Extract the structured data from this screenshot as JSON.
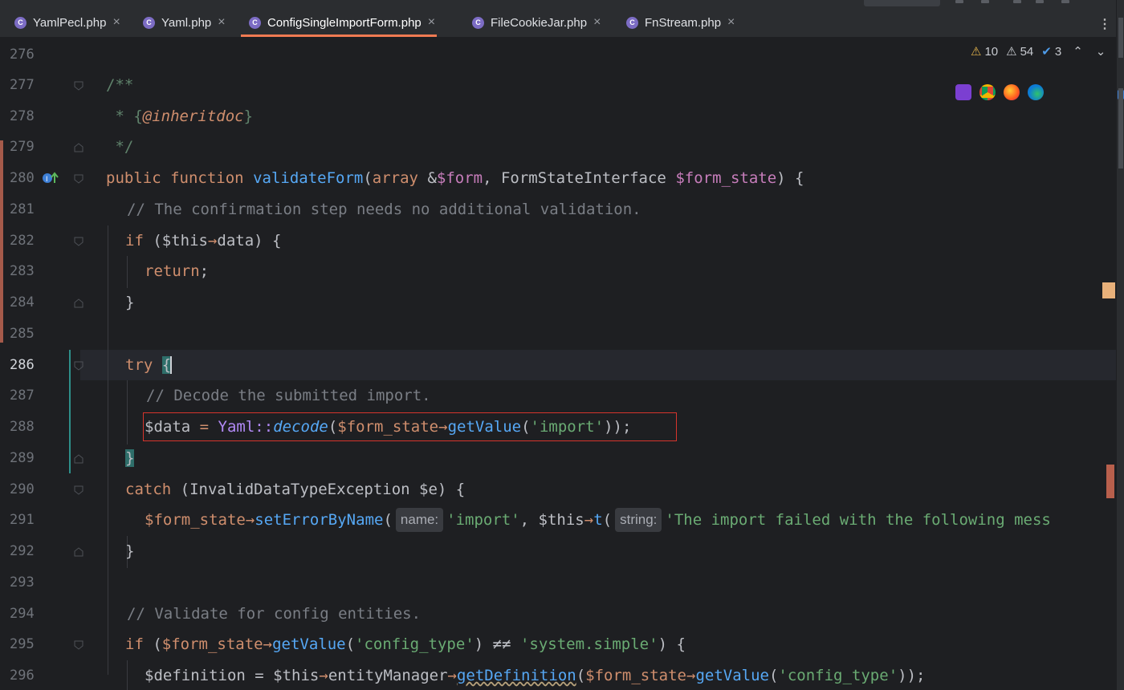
{
  "tabs": [
    {
      "label": "YamlPecl.php",
      "active": false
    },
    {
      "label": "Yaml.php",
      "active": false
    },
    {
      "label": "ConfigSingleImportForm.php",
      "active": true
    },
    {
      "label": "FileCookieJar.php",
      "active": false
    },
    {
      "label": "FnStream.php",
      "active": false
    }
  ],
  "inspections": {
    "weak_warnings": "10",
    "warnings": "54",
    "typos": "3"
  },
  "browsers": [
    "phpstorm-icon",
    "chrome-icon",
    "firefox-icon",
    "edge-icon"
  ],
  "current_line": "286",
  "lines": [
    "276",
    "277",
    "278",
    "279",
    "280",
    "281",
    "282",
    "283",
    "284",
    "285",
    "286",
    "287",
    "288",
    "289",
    "290",
    "291",
    "292",
    "293",
    "294",
    "295",
    "296"
  ],
  "code": {
    "l277": "/**",
    "l278_star": " * {",
    "l278_tag": "@inheritdoc",
    "l278_end": "}",
    "l279": " */",
    "l280_kw1": "public",
    "l280_kw2": "function",
    "l280_fn": "validateForm",
    "l280_p1": "(",
    "l280_kw3": "array",
    "l280_amp": " &",
    "l280_v1": "$form",
    "l280_c": ", FormStateInterface ",
    "l280_v2": "$form_state",
    "l280_end": ") {",
    "l281": "// The confirmation step needs no additional validation.",
    "l282_kw": "if",
    "l282_a": " ($this",
    "l282_arrow": "→",
    "l282_b": "data) {",
    "l283_kw": "return",
    "l283_end": ";",
    "l284": "}",
    "l286_kw": "try",
    "l286_brace": "{",
    "l287": "// Decode the submitted import.",
    "l288_v": "$data",
    "l288_eq": " = ",
    "l288_cls": "Yaml",
    "l288_sep": "::",
    "l288_fn": "decode",
    "l288_p": "(",
    "l288_v2": "$form_state",
    "l288_arrow": "→",
    "l288_m": "getValue",
    "l288_p2": "(",
    "l288_s": "'import'",
    "l288_end": "));",
    "l289": "}",
    "l290_kw": "catch",
    "l290_rest": " (InvalidDataTypeException $e) {",
    "l291_v": "$form_state",
    "l291_arrow": "→",
    "l291_m": "setErrorByName",
    "l291_p": "(",
    "l291_hint1": "name:",
    "l291_s1": "'import'",
    "l291_c": ", $this",
    "l291_arrow2": "→",
    "l291_t": "t",
    "l291_p2": "(",
    "l291_hint2": "string:",
    "l291_s2": "'The import failed with the following mess",
    "l292": "}",
    "l294": "// Validate for config entities.",
    "l295_kw": "if",
    "l295_a": " (",
    "l295_v": "$form_state",
    "l295_arrow": "→",
    "l295_m": "getValue",
    "l295_p": "(",
    "l295_s1": "'config_type'",
    "l295_neq": ") ≠≠ ",
    "l295_s2": "'system.simple'",
    "l295_end": ") {",
    "l296_v": "$definition",
    "l296_eq": " = $this",
    "l296_arrow": "→",
    "l296_prop": "entityManager",
    "l296_arrow2": "→",
    "l296_m": "getDefinition",
    "l296_p": "(",
    "l296_v2": "$form_state",
    "l296_arrow3": "→",
    "l296_m2": "getValue",
    "l296_p2": "(",
    "l296_s": "'config_type'",
    "l296_end": "));"
  },
  "colors": {
    "accent": "#f07a52",
    "keyword": "#cf8e6d",
    "method": "#56a8f5",
    "variable": "#c77dbb",
    "string": "#6aab73",
    "comment": "#7a7e85"
  }
}
